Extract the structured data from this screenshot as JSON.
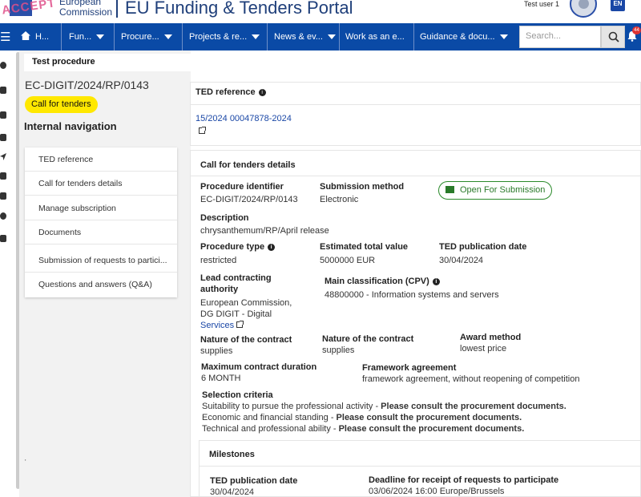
{
  "header": {
    "stamp": "ACCEPT",
    "logo_line1": "European",
    "logo_line2": "Commission",
    "portal_title": "EU Funding & Tenders Portal",
    "user_name": "Test user 1",
    "language": "EN"
  },
  "nav": {
    "items": [
      {
        "label": "H..."
      },
      {
        "label": "Fun..."
      },
      {
        "label": "Procure..."
      },
      {
        "label": "Projects & re..."
      },
      {
        "label": "News & ev..."
      },
      {
        "label": "Work as an e..."
      },
      {
        "label": "Guidance & docu..."
      }
    ],
    "search_placeholder": "Search...",
    "notification_count": "44"
  },
  "left": {
    "procedure_title": "Test procedure",
    "procedure_id": "EC-DIGIT/2024/RP/0143",
    "badge": "Call for tenders",
    "internal_nav_title": "Internal navigation",
    "menu": [
      "TED reference",
      "Call for tenders details",
      "Manage subscription",
      "Documents",
      "Submission of requests to partici...",
      "Questions and answers (Q&A)"
    ],
    "bottom_mark": "'"
  },
  "ted": {
    "title": "TED reference",
    "link": "15/2024 00047878-2024"
  },
  "details": {
    "title": "Call for tenders details",
    "procedure_identifier_label": "Procedure identifier",
    "procedure_identifier": "EC-DIGIT/2024/RP/0143",
    "submission_method_label": "Submission method",
    "submission_method": "Electronic",
    "status_button": "Open For Submission",
    "description_label": "Description",
    "description": "chrysanthemum/RP/April release",
    "procedure_type_label": "Procedure type",
    "procedure_type": "restricted",
    "estimated_value_label": "Estimated total value",
    "estimated_value": "5000000 EUR",
    "ted_pub_label": "TED publication date",
    "ted_pub": "30/04/2024",
    "lead_authority_label_1": "Lead contracting",
    "lead_authority_label_2": "authority",
    "lead_authority_1": "European Commission,",
    "lead_authority_2": "DG DIGIT - Digital",
    "lead_authority_3": "Services",
    "cpv_label": "Main classification (CPV)",
    "cpv": "48800000 - Information systems and servers",
    "nature1_label": "Nature of the contract",
    "nature1": "supplies",
    "nature2_label": "Nature of the contract",
    "nature2": "supplies",
    "award_label": "Award method",
    "award": "lowest price",
    "max_duration_label": "Maximum contract duration",
    "max_duration": "6 MONTH",
    "framework_label": "Framework agreement",
    "framework": "framework agreement, without reopening of competition",
    "selection_label": "Selection criteria",
    "sel1_pre": "Suitability to pursue the professional activity - ",
    "sel1_bold": "Please consult the procurement documents.",
    "sel2_pre": "Economic and financial standing - ",
    "sel2_bold": "Please consult the procurement documents.",
    "sel3_pre": "Technical and professional ability - ",
    "sel3_bold": "Please consult the procurement documents."
  },
  "milestones": {
    "title": "Milestones",
    "ted_label": "TED publication date",
    "ted_date": "30/04/2024",
    "deadline_label": "Deadline for receipt of requests to participate",
    "deadline": "03/06/2024 16:00 Europe/Brussels"
  }
}
